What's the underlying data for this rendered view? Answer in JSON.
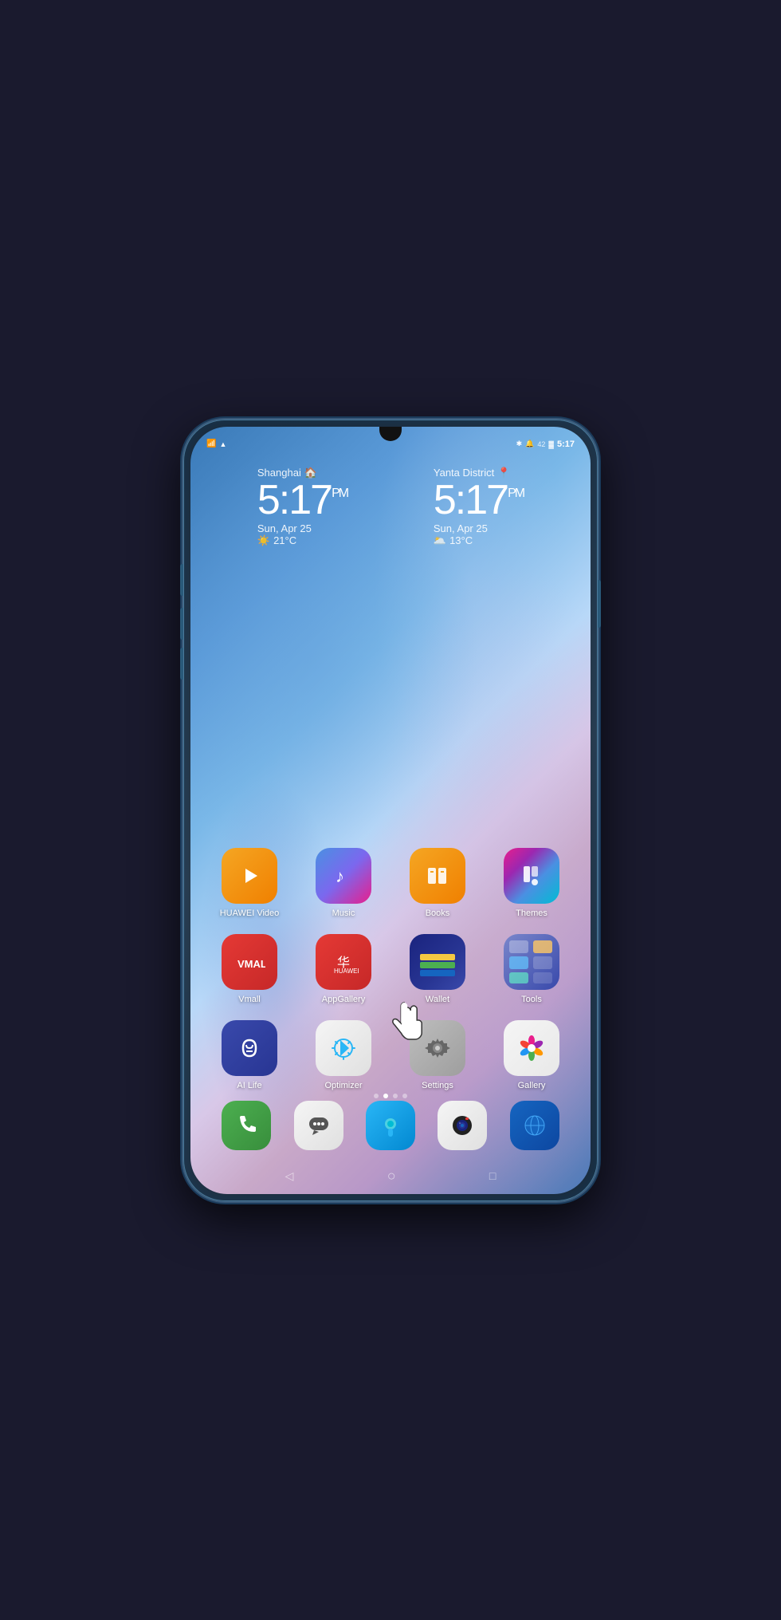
{
  "phone": {
    "status_bar": {
      "left_icons": [
        "sim-icon",
        "wifi-icon"
      ],
      "right_icons": [
        "bluetooth-icon",
        "bell-icon",
        "battery-icon"
      ],
      "battery_level": "42",
      "time": "5:17"
    },
    "clock_widgets": [
      {
        "city": "Shanghai",
        "city_icon": "home",
        "time": "5:17",
        "ampm": "PM",
        "date": "Sun, Apr 25",
        "weather_icon": "☀️",
        "temp": "21°C"
      },
      {
        "city": "Yanta District",
        "city_icon": "pin",
        "time": "5:17",
        "ampm": "PM",
        "date": "Sun, Apr 25",
        "weather_icon": "☁️",
        "temp": "13°C"
      }
    ],
    "apps": [
      {
        "id": "huawei-video",
        "label": "HUAWEI Video",
        "icon_type": "huawei-video",
        "row": 1
      },
      {
        "id": "music",
        "label": "Music",
        "icon_type": "music",
        "row": 1
      },
      {
        "id": "books",
        "label": "Books",
        "icon_type": "books",
        "row": 1
      },
      {
        "id": "themes",
        "label": "Themes",
        "icon_type": "themes",
        "row": 1
      },
      {
        "id": "vmall",
        "label": "Vmall",
        "icon_type": "vmall",
        "row": 2
      },
      {
        "id": "appgallery",
        "label": "AppGallery",
        "icon_type": "appgallery",
        "row": 2
      },
      {
        "id": "wallet",
        "label": "Wallet",
        "icon_type": "wallet",
        "row": 2
      },
      {
        "id": "tools",
        "label": "Tools",
        "icon_type": "tools",
        "row": 2
      },
      {
        "id": "ai-life",
        "label": "AI Life",
        "icon_type": "ai-life",
        "row": 3
      },
      {
        "id": "optimizer",
        "label": "Optimizer",
        "icon_type": "optimizer",
        "row": 3
      },
      {
        "id": "settings",
        "label": "Settings",
        "icon_type": "settings",
        "row": 3
      },
      {
        "id": "gallery",
        "label": "Gallery",
        "icon_type": "gallery",
        "row": 3
      }
    ],
    "dock_apps": [
      {
        "id": "phone",
        "icon_type": "phone"
      },
      {
        "id": "messages",
        "icon_type": "messages"
      },
      {
        "id": "support",
        "icon_type": "support"
      },
      {
        "id": "camera",
        "icon_type": "camera"
      },
      {
        "id": "browser",
        "icon_type": "browser"
      }
    ],
    "page_dots": [
      {
        "active": false
      },
      {
        "active": true
      },
      {
        "active": false
      },
      {
        "active": false
      }
    ],
    "nav": {
      "back": "◁",
      "home": "○",
      "recents": "□"
    }
  }
}
